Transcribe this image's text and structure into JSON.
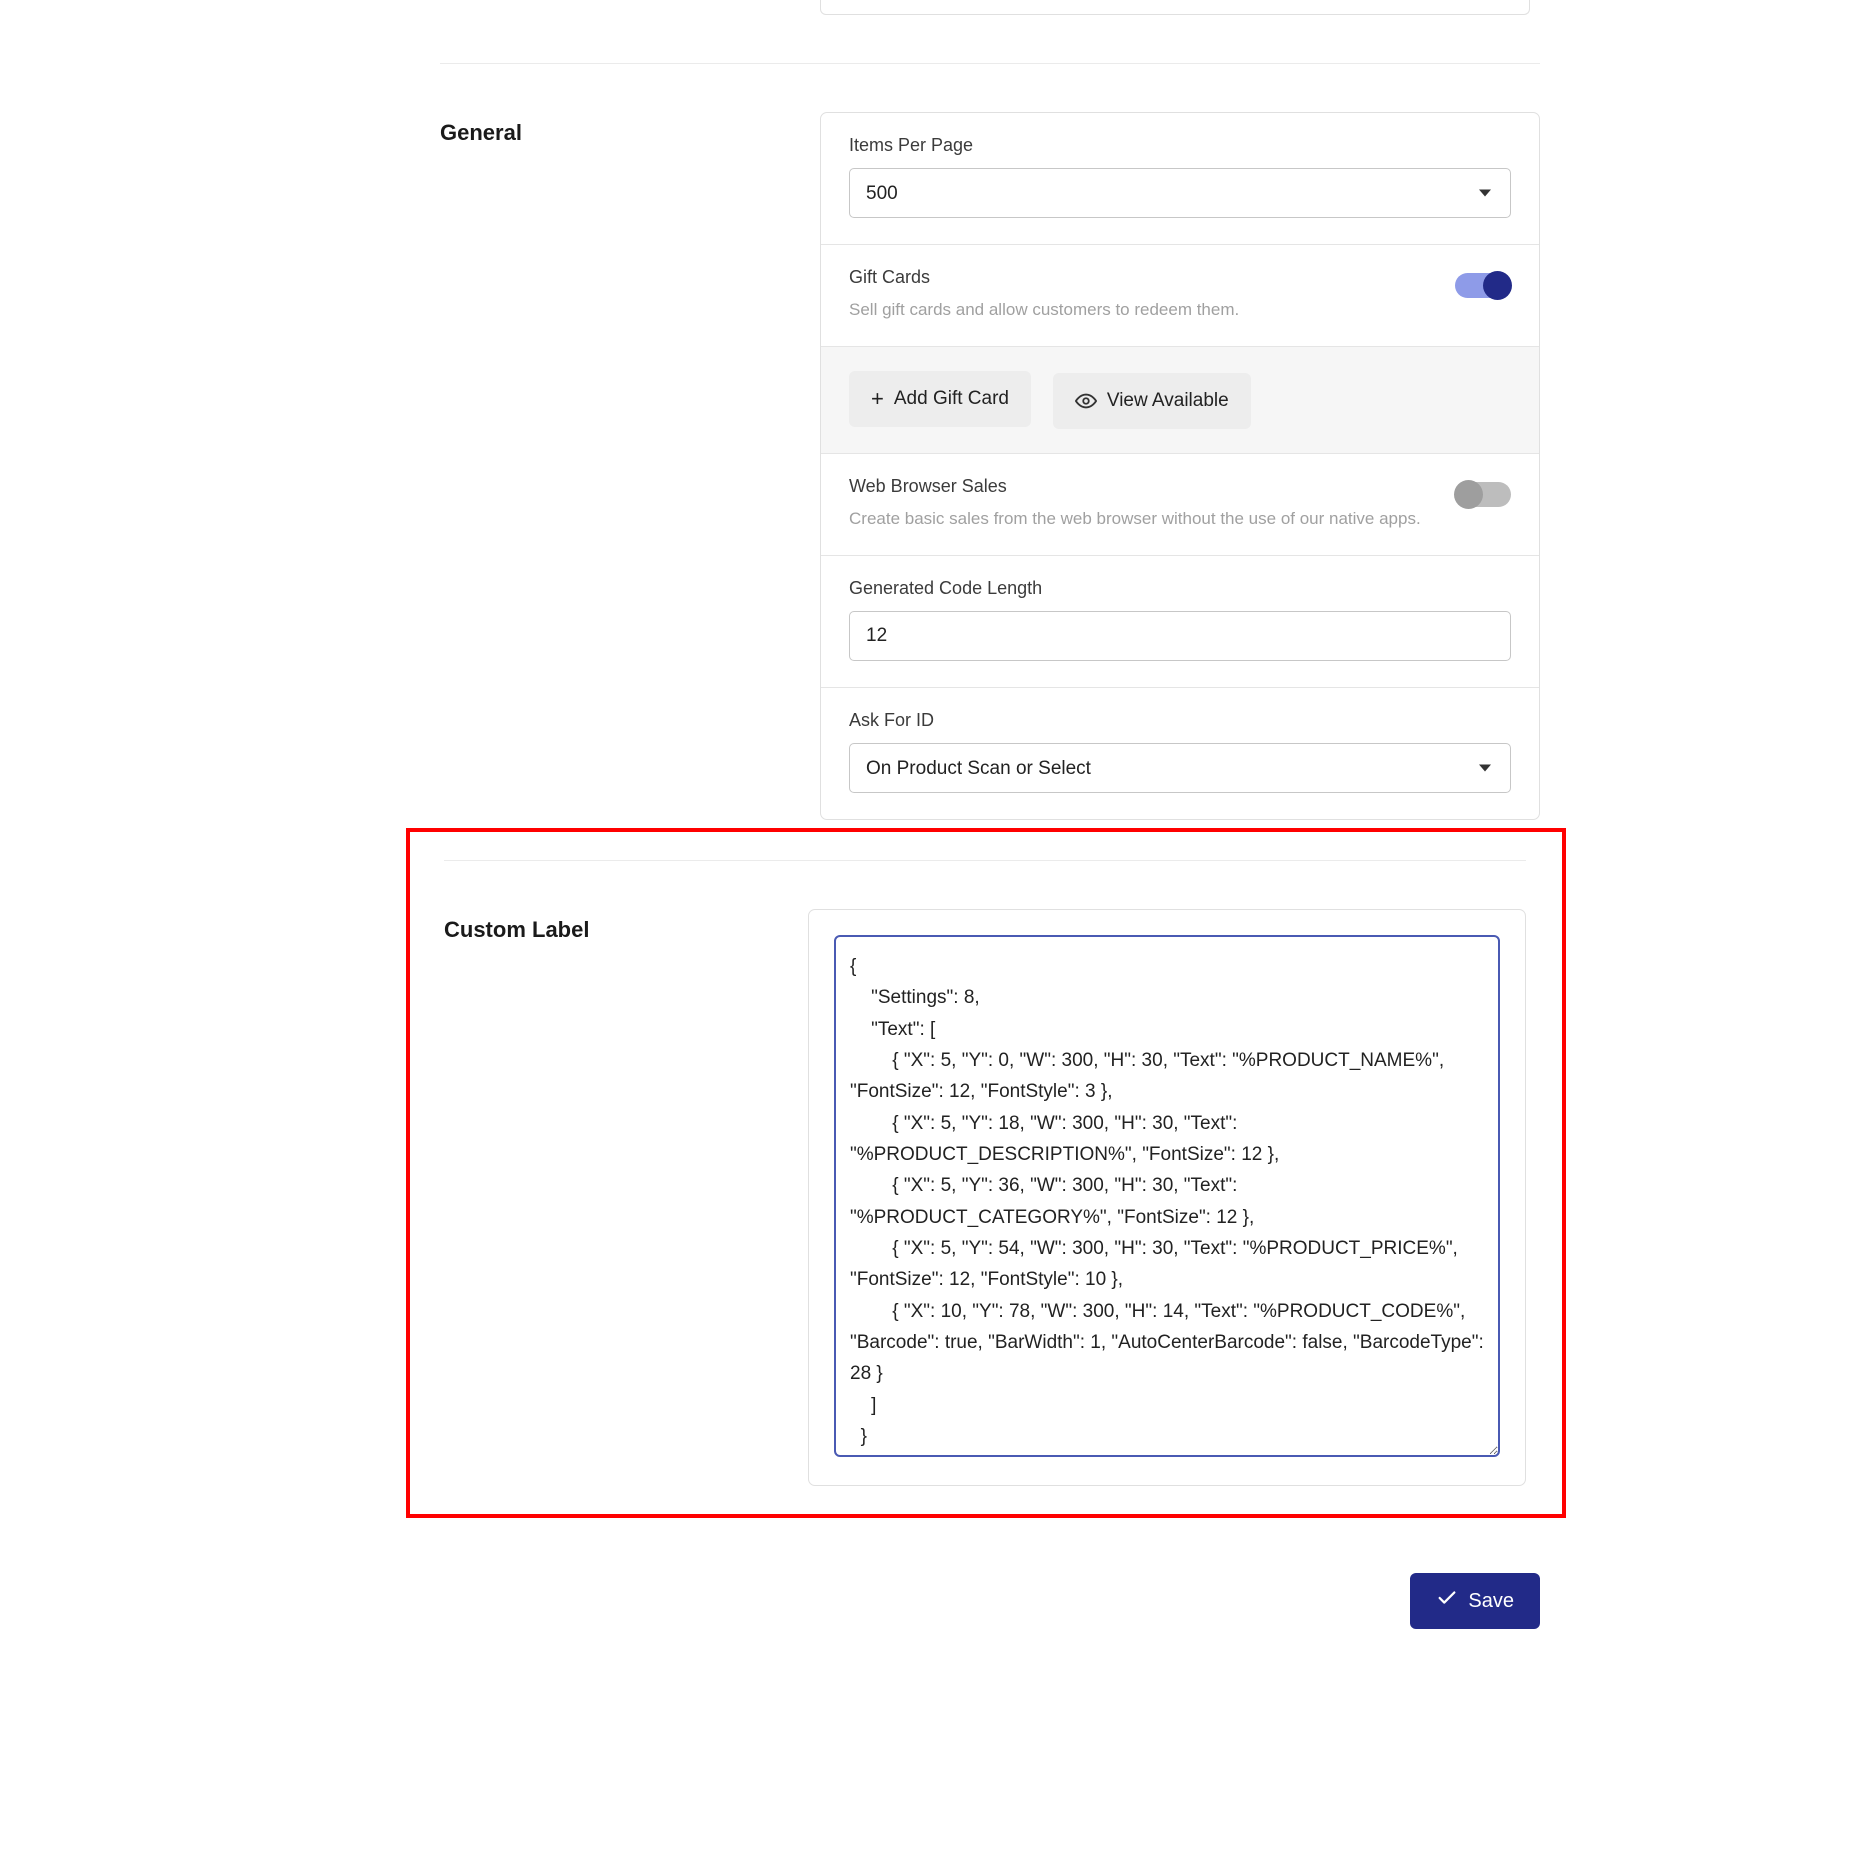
{
  "sections": {
    "general": {
      "title": "General",
      "items_per_page": {
        "label": "Items Per Page",
        "value": "500"
      },
      "gift_cards": {
        "label": "Gift Cards",
        "description": "Sell gift cards and allow customers to redeem them.",
        "enabled": true,
        "add_button": "Add Gift Card",
        "view_button": "View Available"
      },
      "web_browser_sales": {
        "label": "Web Browser Sales",
        "description": "Create basic sales from the web browser without the use of our native apps.",
        "enabled": false
      },
      "generated_code_length": {
        "label": "Generated Code Length",
        "value": "12"
      },
      "ask_for_id": {
        "label": "Ask For ID",
        "value": "On Product Scan or Select"
      }
    },
    "custom_label": {
      "title": "Custom Label",
      "value": "{\n    \"Settings\": 8,\n    \"Text\": [\n        { \"X\": 5, \"Y\": 0, \"W\": 300, \"H\": 30, \"Text\": \"%PRODUCT_NAME%\", \"FontSize\": 12, \"FontStyle\": 3 },\n        { \"X\": 5, \"Y\": 18, \"W\": 300, \"H\": 30, \"Text\": \"%PRODUCT_DESCRIPTION%\", \"FontSize\": 12 },\n        { \"X\": 5, \"Y\": 36, \"W\": 300, \"H\": 30, \"Text\": \"%PRODUCT_CATEGORY%\", \"FontSize\": 12 },\n        { \"X\": 5, \"Y\": 54, \"W\": 300, \"H\": 30, \"Text\": \"%PRODUCT_PRICE%\", \"FontSize\": 12, \"FontStyle\": 10 },\n        { \"X\": 10, \"Y\": 78, \"W\": 300, \"H\": 14, \"Text\": \"%PRODUCT_CODE%\", \"Barcode\": true, \"BarWidth\": 1, \"AutoCenterBarcode\": false, \"BarcodeType\": 28 }\n    ]\n  }"
    }
  },
  "footer": {
    "save": "Save"
  }
}
